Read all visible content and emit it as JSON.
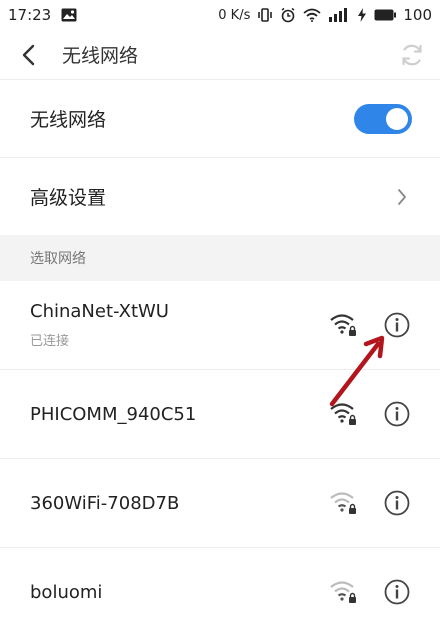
{
  "status_bar": {
    "time": "17:23",
    "speed": "0 K/s",
    "battery": "100"
  },
  "header": {
    "title": "无线网络"
  },
  "settings": {
    "wifi_label": "无线网络",
    "wifi_enabled": true,
    "advanced_label": "高级设置"
  },
  "section": {
    "title": "选取网络"
  },
  "networks": [
    {
      "ssid": "ChinaNet-XtWU",
      "status": "已连接",
      "signal": "strong",
      "secured": true
    },
    {
      "ssid": "PHICOMM_940C51",
      "status": "",
      "signal": "strong",
      "secured": true
    },
    {
      "ssid": "360WiFi-708D7B",
      "status": "",
      "signal": "weak",
      "secured": true
    },
    {
      "ssid": "boluomi",
      "status": "",
      "signal": "weak",
      "secured": true
    }
  ],
  "colors": {
    "accent": "#2f86e8",
    "annotation_arrow": "#b3151c"
  },
  "icons": [
    "back-arrow-icon",
    "refresh-icon",
    "chevron-right-icon",
    "wifi-lock-icon",
    "info-icon"
  ]
}
